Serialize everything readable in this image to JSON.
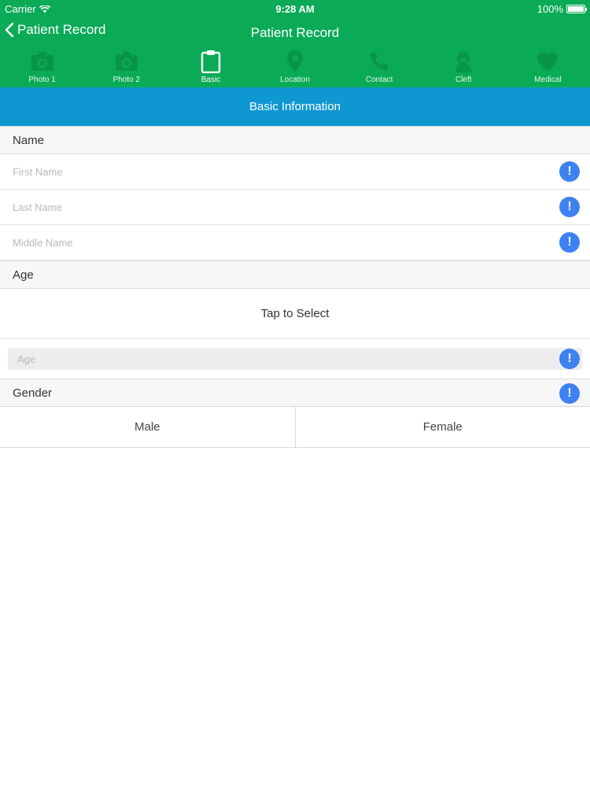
{
  "status_bar": {
    "carrier": "Carrier",
    "time": "9:28 AM",
    "battery": "100%"
  },
  "nav": {
    "back_label": "Patient Record",
    "title": "Patient Record"
  },
  "tabs": [
    {
      "label": "Photo 1",
      "icon": "camera-icon"
    },
    {
      "label": "Photo 2",
      "icon": "camera-icon"
    },
    {
      "label": "Basic",
      "icon": "clipboard-icon",
      "active": true
    },
    {
      "label": "Location",
      "icon": "location-pin-icon"
    },
    {
      "label": "Contact",
      "icon": "phone-icon"
    },
    {
      "label": "Cleft",
      "icon": "face-icon"
    },
    {
      "label": "Medical",
      "icon": "heart-icon"
    }
  ],
  "section_title": "Basic Information",
  "name_section": {
    "header": "Name",
    "first_name_placeholder": "First Name",
    "last_name_placeholder": "Last Name",
    "middle_name_placeholder": "Middle Name"
  },
  "age_section": {
    "header": "Age",
    "tap_to_select": "Tap to Select",
    "age_placeholder": "Age"
  },
  "gender_section": {
    "header": "Gender",
    "options": [
      "Male",
      "Female"
    ]
  },
  "colors": {
    "header_green": "#0baa57",
    "banner_blue": "#0f97d2",
    "alert_blue": "#3d82f0"
  }
}
